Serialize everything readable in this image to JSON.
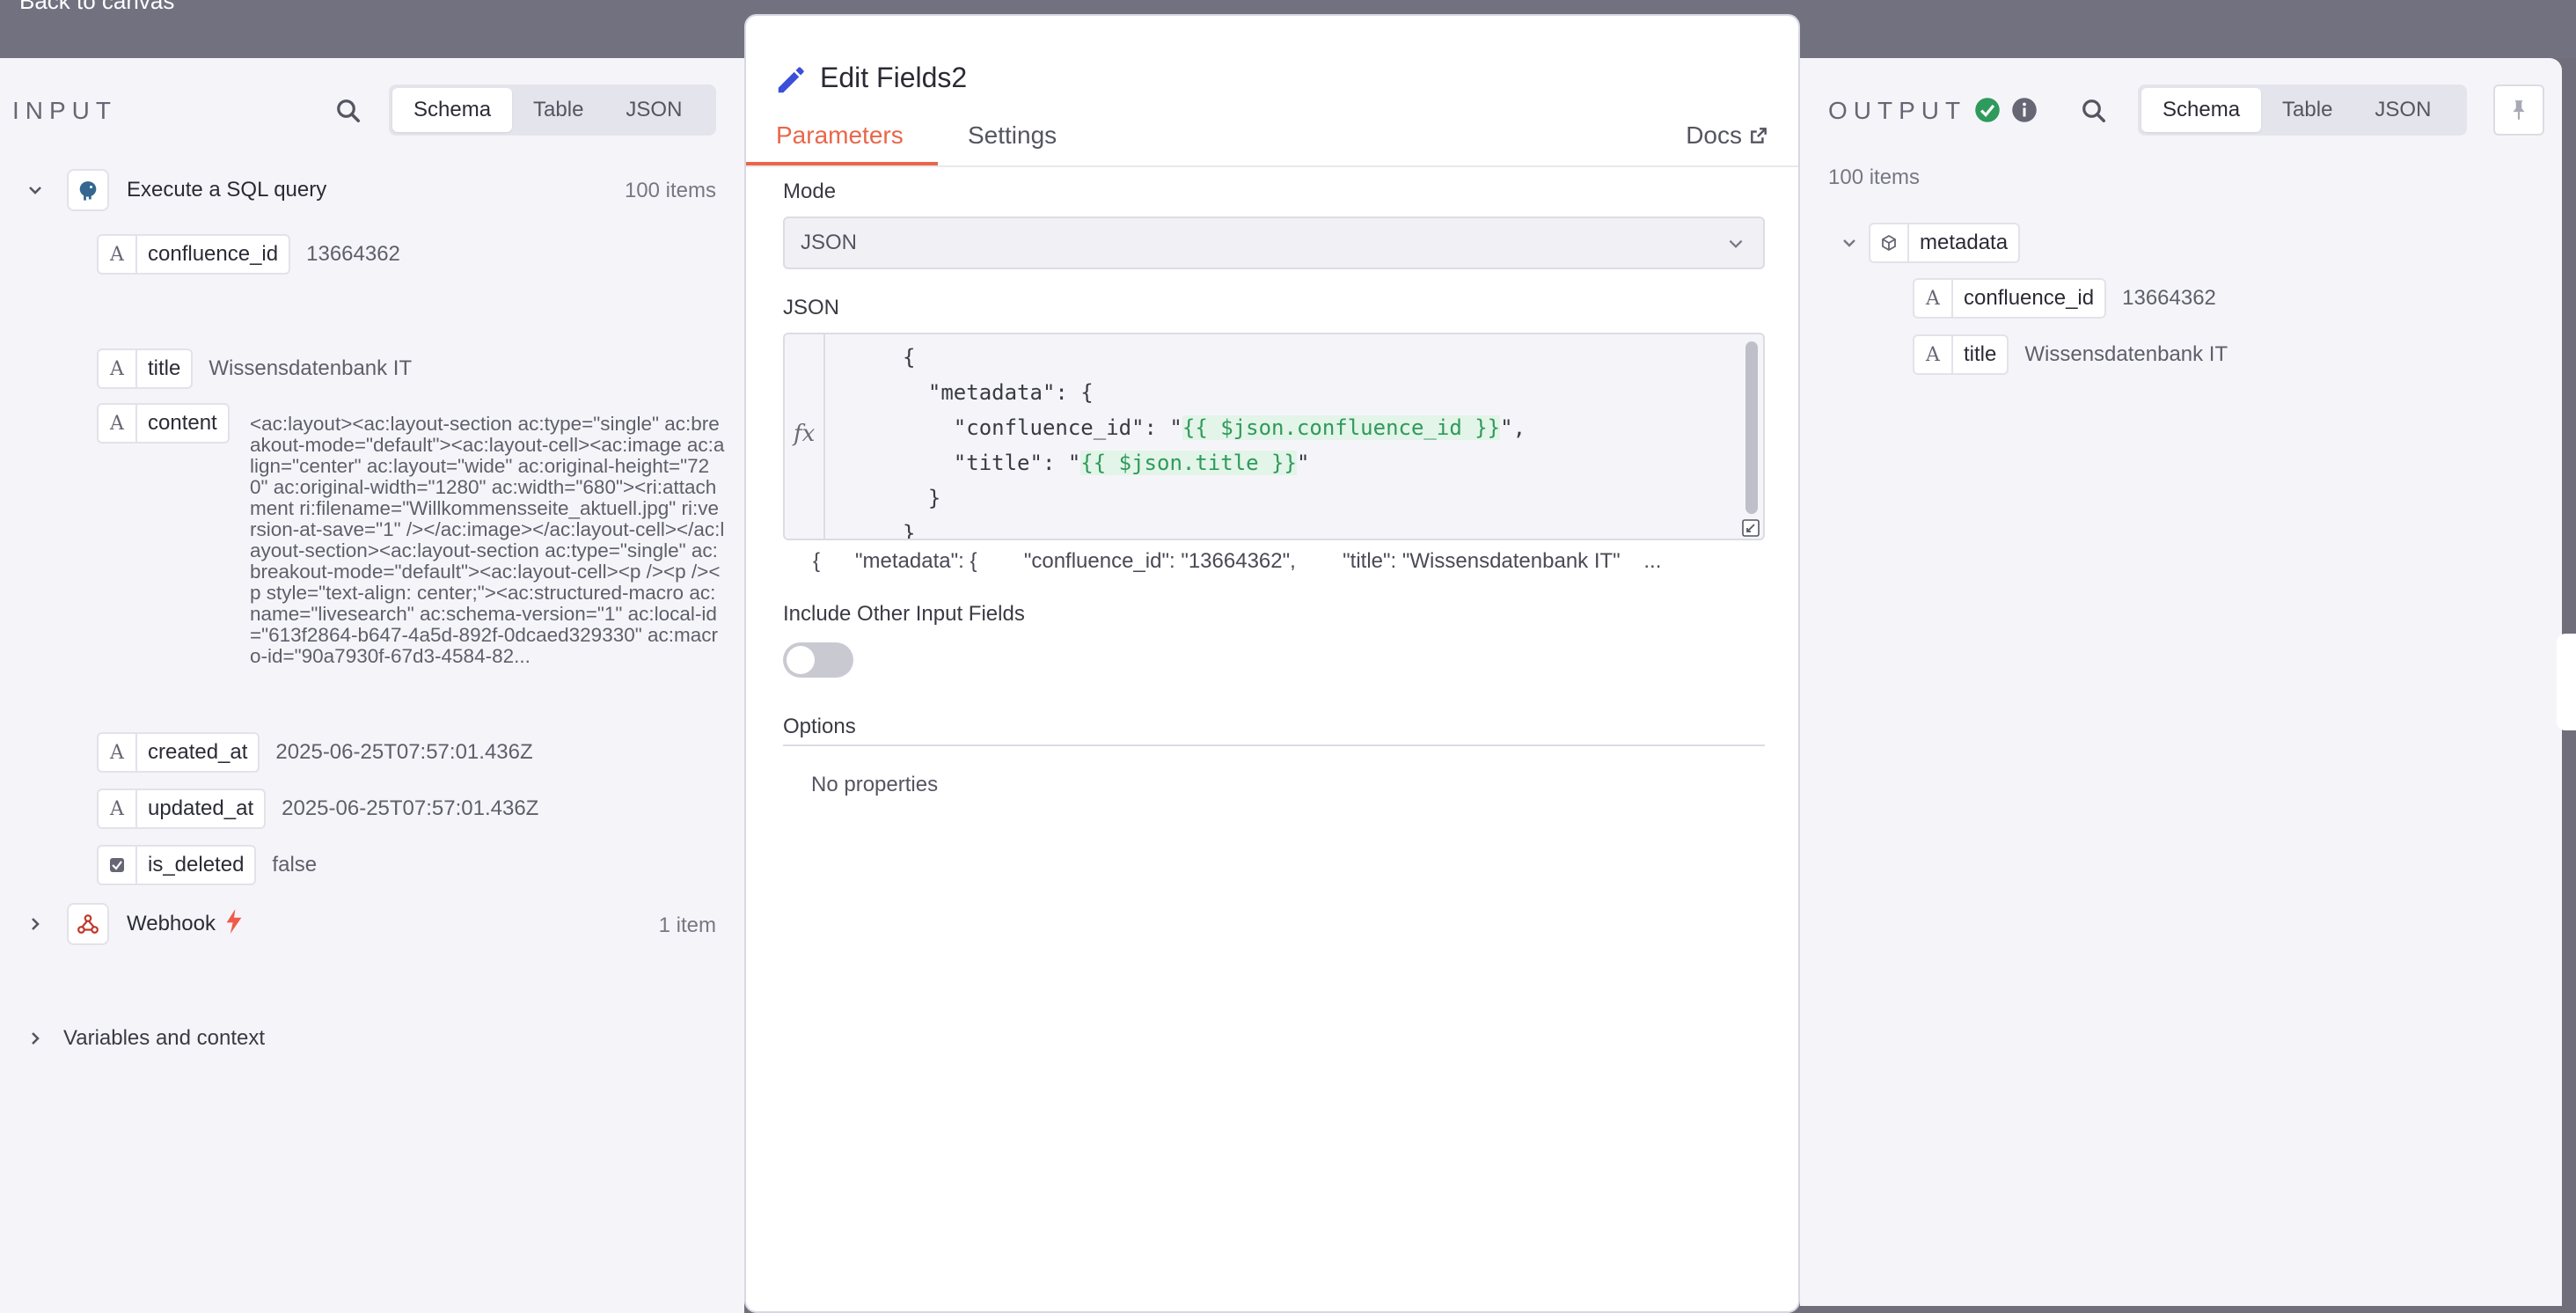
{
  "topbar": {
    "back_label": "Back to canvas"
  },
  "input": {
    "title": "INPUT",
    "tabs": [
      "Schema",
      "Table",
      "JSON"
    ],
    "nodes": [
      {
        "name": "Execute a SQL query",
        "count": "100 items",
        "fields": [
          {
            "type": "A",
            "name": "confluence_id",
            "value": "13664362"
          },
          {
            "type": "A",
            "name": "title",
            "value": "Wissensdatenbank IT"
          },
          {
            "type": "A",
            "name": "content",
            "value": "<ac:layout><ac:layout-section ac:type=\"single\" ac:breakout-mode=\"default\"><ac:layout-cell><ac:image ac:align=\"center\" ac:layout=\"wide\" ac:original-height=\"720\" ac:original-width=\"1280\" ac:width=\"680\"><ri:attachment ri:filename=\"Willkommensseite_aktuell.jpg\" ri:version-at-save=\"1\" /></ac:image></ac:layout-cell></ac:layout-section><ac:layout-section ac:type=\"single\" ac:breakout-mode=\"default\"><ac:layout-cell><p /><p /><p style=\"text-align: center;\"><ac:structured-macro ac:name=\"livesearch\" ac:schema-version=\"1\" ac:local-id=\"613f2864-b647-4a5d-892f-0dcaed329330\" ac:macro-id=\"90a7930f-67d3-4584-82..."
          },
          {
            "type": "A",
            "name": "created_at",
            "value": "2025-06-25T07:57:01.436Z"
          },
          {
            "type": "A",
            "name": "updated_at",
            "value": "2025-06-25T07:57:01.436Z"
          },
          {
            "type": "checkbox",
            "name": "is_deleted",
            "value": "false"
          }
        ]
      },
      {
        "name": "Webhook",
        "count": "1 item"
      }
    ],
    "variables_label": "Variables and context"
  },
  "ndv": {
    "title": "Edit Fields2",
    "tabs": {
      "parameters": "Parameters",
      "settings": "Settings",
      "docs": "Docs"
    },
    "mode_label": "Mode",
    "mode_value": "JSON",
    "json_label": "JSON",
    "code": {
      "l1": "{",
      "l2": "  \"metadata\": {",
      "l3_key": "    \"confluence_id\": \"",
      "l3_expr": "{{ $json.confluence_id }}",
      "l3_end": "\",",
      "l4_key": "    \"title\": \"",
      "l4_expr": "{{ $json.title }}",
      "l4_end": "\"",
      "l5": "  }",
      "l6": "}"
    },
    "preview": "{      \"metadata\": {        \"confluence_id\": \"13664362\",        \"title\": \"Wissensdatenbank IT\"    ...",
    "include_label": "Include Other Input Fields",
    "options_label": "Options",
    "no_properties": "No properties"
  },
  "output": {
    "title": "OUTPUT",
    "tabs": [
      "Schema",
      "Table",
      "JSON"
    ],
    "count": "100 items",
    "object_name": "metadata",
    "fields": [
      {
        "type": "A",
        "name": "confluence_id",
        "value": "13664362"
      },
      {
        "type": "A",
        "name": "title",
        "value": "Wissensdatenbank IT"
      }
    ]
  }
}
